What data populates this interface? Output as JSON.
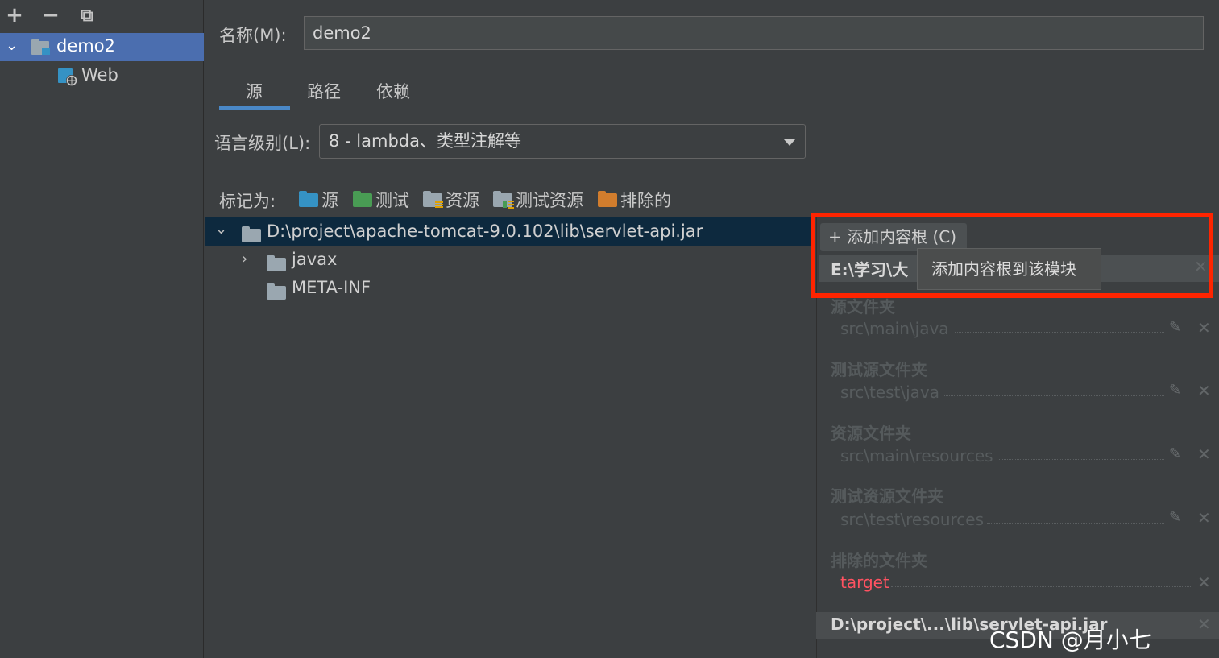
{
  "toolbar": {
    "add": "+",
    "remove": "−",
    "copy": "⧉"
  },
  "modules_tree": {
    "root": "demo2",
    "child": "Web"
  },
  "name_field": {
    "label": "名称(M):",
    "value": "demo2"
  },
  "tabs": [
    {
      "label": "源"
    },
    {
      "label": "路径"
    },
    {
      "label": "依赖"
    }
  ],
  "language_level": {
    "label": "语言级别(L):",
    "value": "8 - lambda、类型注解等"
  },
  "mark_as": {
    "label": "标记为:",
    "items": [
      {
        "label": "源",
        "color": "#3592c4"
      },
      {
        "label": "测试",
        "color": "#499c54"
      },
      {
        "label": "资源",
        "color": "#9aa7b0"
      },
      {
        "label": "测试资源",
        "color": "#9aa7b0"
      },
      {
        "label": "排除的",
        "color": "#d27d2d"
      }
    ]
  },
  "file_tree": {
    "root": "D:\\project\\apache-tomcat-9.0.102\\lib\\servlet-api.jar",
    "children": [
      "javax",
      "META-INF"
    ]
  },
  "content_roots": {
    "add_button": "+ 添加内容根 (C)",
    "tooltip": "添加内容根到该模块",
    "current_root": "E:\\学习\\大",
    "sections": [
      {
        "title": "源文件夹",
        "path": "src\\main\\java"
      },
      {
        "title": "测试源文件夹",
        "path": "src\\test\\java"
      },
      {
        "title": "资源文件夹",
        "path": "src\\main\\resources"
      },
      {
        "title": "测试资源文件夹",
        "path": "src\\test\\resources"
      },
      {
        "title": "排除的文件夹",
        "path": "target",
        "path_color": "#ff5261"
      }
    ],
    "bottom_root": "D:\\project\\...\\lib\\servlet-api.jar"
  },
  "watermark": "CSDN @月小七_lucky"
}
